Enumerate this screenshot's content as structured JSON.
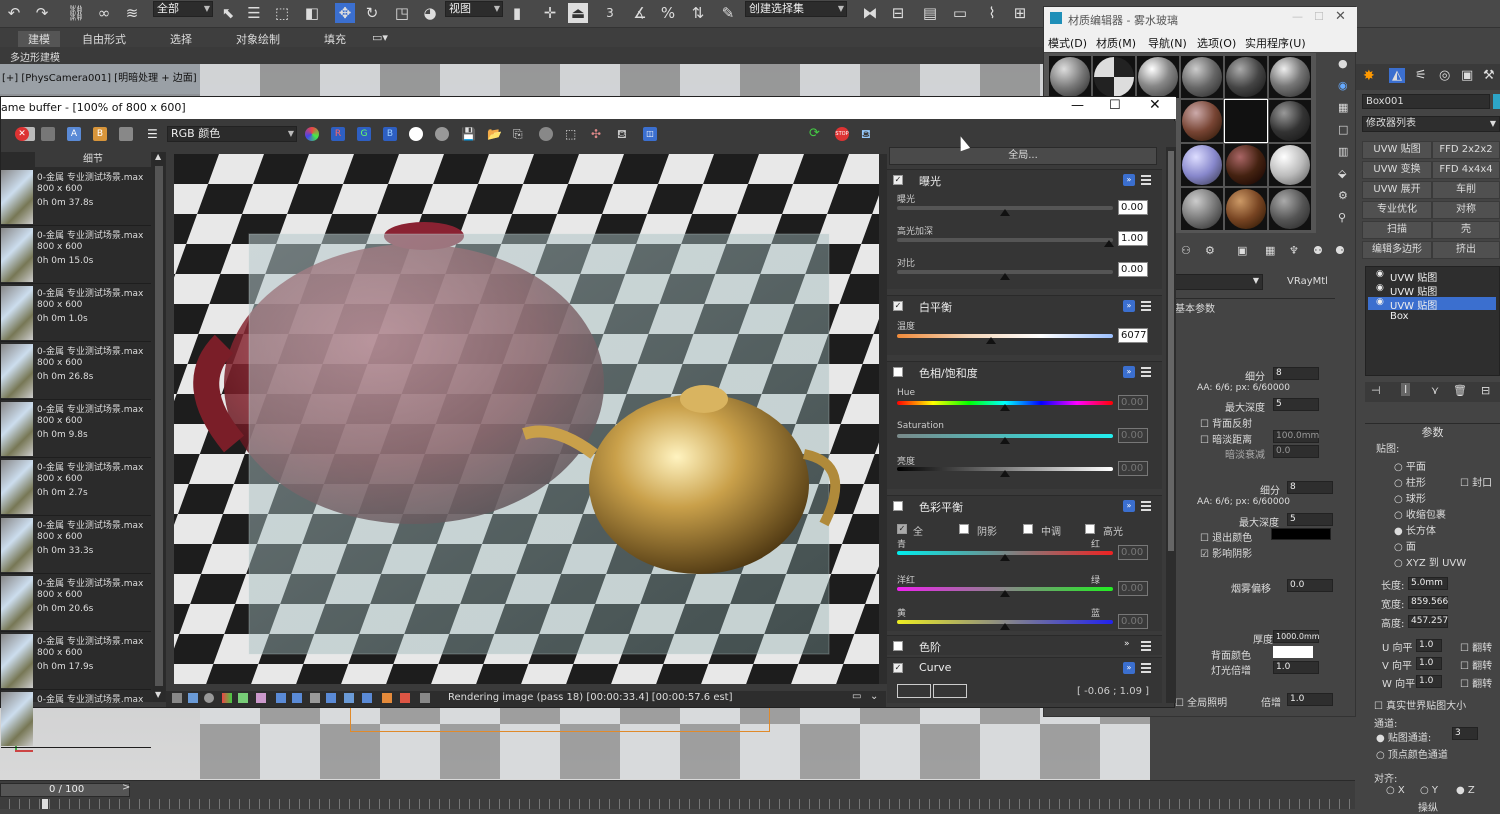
{
  "toolbar": {
    "select_filter": "全部",
    "view_combo": "视图",
    "selection_set": "创建选择集",
    "num_label": "3"
  },
  "ribbon": {
    "tabs": [
      "建模",
      "自由形式",
      "选择",
      "对象绘制",
      "填充"
    ],
    "sub": "多边形建模"
  },
  "viewport": {
    "label": "[+] [PhysCamera001] [明暗处理 + 边面]"
  },
  "timeline": {
    "frame": "0 / 100"
  },
  "material_editor": {
    "title": "材质编辑器 - 雾水玻璃",
    "menu": [
      "模式(D)",
      "材质(M)",
      "导航(N)",
      "选项(O)",
      "实用程序(U)"
    ],
    "type": "VRayMtl",
    "section": "基本参数",
    "params": {
      "subdiv1_label": "细分",
      "subdiv1_val": "8",
      "aa1": "AA: 6/6; px: 6/60000",
      "maxdepth1_label": "最大深度",
      "maxdepth1_val": "5",
      "backface": "背面反射",
      "dim_dist": "暗淡距离",
      "dim_dist_val": "100.0mm",
      "dim_falloff": "暗淡衰减",
      "dim_falloff_val": "0.0",
      "subdiv2_label": "细分",
      "subdiv2_val": "8",
      "aa2": "AA: 6/6; px: 6/60000",
      "maxdepth2_label": "最大深度",
      "maxdepth2_val": "5",
      "exit_color": "退出颜色",
      "affect_shadow": "影响阴影",
      "fog_bias": "烟雾偏移",
      "fog_bias_val": "0.0",
      "thickness": "厚度",
      "thickness_val": "1000.0mm",
      "back_color": "背面颜色",
      "light_mult": "灯光倍增",
      "light_mult_val": "1.0",
      "gi": "全局照明",
      "gi_mult": "倍增",
      "gi_val": "1.0"
    }
  },
  "cmd_panel": {
    "object_name": "Box001",
    "modifier_list": "修改器列表",
    "buttons": [
      "UVW 贴图",
      "FFD 2x2x2",
      "UVW 变换",
      "FFD 4x4x4",
      "UVW 展开",
      "车削",
      "专业优化",
      "对称",
      "扫描",
      "壳",
      "编辑多边形",
      "挤出"
    ],
    "stack": [
      "UVW 贴图",
      "UVW 贴图",
      "UVW 贴图",
      "Box"
    ],
    "params_title": "参数",
    "mapping_label": "贴图:",
    "mapping": [
      "平面",
      "柱形",
      "球形",
      "收缩包裹",
      "长方体",
      "面",
      "XYZ 到 UVW"
    ],
    "cap": "封口",
    "length_label": "长度:",
    "length_val": "5.0mm",
    "width_label": "宽度:",
    "width_val": "859.566",
    "height_label": "高度:",
    "height_val": "457.257",
    "u_tile": "U 向平",
    "v_tile": "V 向平",
    "w_tile": "W 向平",
    "tile_val": "1.0",
    "flip": "翻转",
    "realworld": "真实世界贴图大小",
    "channel_label": "通道:",
    "map_channel": "贴图通道:",
    "map_channel_val": "3",
    "vertex_channel": "顶点颜色通道",
    "align_label": "对齐:",
    "axes": [
      "X",
      "Y",
      "Z"
    ],
    "fit": "操纵"
  },
  "vfb": {
    "title": "ame buffer - [100% of 800 x 600]",
    "channel": "RGB 颜色",
    "history_header": "细节",
    "history": [
      {
        "name": "0-金属 专业测试场景.max",
        "size": "800 x 600",
        "time": "0h 0m 37.8s"
      },
      {
        "name": "0-金属 专业测试场景.max",
        "size": "800 x 600",
        "time": "0h 0m 15.0s"
      },
      {
        "name": "0-金属 专业测试场景.max",
        "size": "800 x 600",
        "time": "0h 0m 1.0s"
      },
      {
        "name": "0-金属 专业测试场景.max",
        "size": "800 x 600",
        "time": "0h 0m 26.8s"
      },
      {
        "name": "0-金属 专业测试场景.max",
        "size": "800 x 600",
        "time": "0h 0m 9.8s"
      },
      {
        "name": "0-金属 专业测试场景.max",
        "size": "800 x 600",
        "time": "0h 0m 2.7s"
      },
      {
        "name": "0-金属 专业测试场景.max",
        "size": "800 x 600",
        "time": "0h 0m 33.3s"
      },
      {
        "name": "0-金属 专业测试场景.max",
        "size": "800 x 600",
        "time": "0h 0m 20.6s"
      },
      {
        "name": "0-金属 专业测试场景.max",
        "size": "800 x 600",
        "time": "0h 0m 17.9s"
      },
      {
        "name": "0-金属 专业测试场景.max",
        "size": "",
        "time": ""
      }
    ],
    "status": "Rendering image (pass 18) [00:00:33.4] [00:00:57.6 est]",
    "global_button": "全局...",
    "coords": "[ -0.06 ; 1.09 ]"
  },
  "correction": {
    "exposure": {
      "title": "曝光",
      "exposure_label": "曝光",
      "exposure_val": "0.00",
      "highlight_label": "高光加深",
      "highlight_val": "1.00",
      "contrast_label": "对比",
      "contrast_val": "0.00"
    },
    "white_balance": {
      "title": "白平衡",
      "temp_label": "温度",
      "temp_val": "6077"
    },
    "hue_sat": {
      "title": "色相/饱和度",
      "hue_label": "Hue",
      "hue_val": "0.00",
      "sat_label": "Saturation",
      "sat_val": "0.00",
      "light_label": "亮度",
      "light_val": "0.00"
    },
    "color_balance": {
      "title": "色彩平衡",
      "all": "全",
      "shadows": "阴影",
      "mid": "中调",
      "high": "高光",
      "cyan": "青",
      "red": "红",
      "cr_val": "0.00",
      "magenta": "洋红",
      "green": "绿",
      "mg_val": "0.00",
      "yellow": "黄",
      "blue": "蓝",
      "yb_val": "0.00"
    },
    "levels": {
      "title": "色阶"
    },
    "curve": {
      "title": "Curve"
    }
  }
}
